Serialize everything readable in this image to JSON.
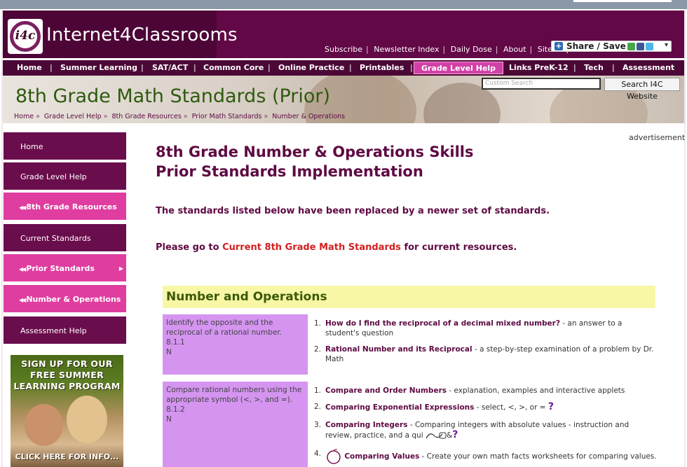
{
  "header": {
    "site_name": "Internet4Classrooms",
    "logo_text": "i4c",
    "toplinks": [
      "Subscribe",
      "Newsletter Index",
      "Daily Dose",
      "About",
      "Site Map"
    ],
    "share_label": "Share / Save"
  },
  "nav": {
    "items": [
      "Home",
      "Summer Learning",
      "SAT/ACT",
      "Common Core",
      "Online Practice",
      "Printables",
      "Grade Level Help",
      "Links PreK-12",
      "Tech",
      "Assessment"
    ],
    "active": "Grade Level Help"
  },
  "banner": {
    "title": "8th Grade Math Standards (Prior)",
    "search_placeholder": "Custom Search",
    "search_button": "Search I4C Website",
    "breadcrumbs": [
      "Home",
      "Grade Level Help",
      "8th Grade Resources",
      "Prior Math Standards",
      "Number & Operations"
    ]
  },
  "sidebar": {
    "items": [
      {
        "label": "Home",
        "style": "dark"
      },
      {
        "label": "Grade Level Help",
        "style": "dark"
      },
      {
        "label": "8th Grade Resources",
        "style": "pink"
      },
      {
        "label": "Current Standards",
        "style": "dark"
      },
      {
        "label": "Prior Standards",
        "style": "pink"
      },
      {
        "label": "Number & Operations",
        "style": "pink"
      },
      {
        "label": "Assessment Help",
        "style": "dark"
      }
    ],
    "ad": {
      "line1": "SIGN UP FOR OUR",
      "line2": "FREE SUMMER",
      "line3": "LEARNING PROGRAM",
      "cta": "CLICK HERE FOR INFO..."
    }
  },
  "main": {
    "advertisement_label": "advertisement",
    "title_line1": "8th Grade Number & Operations Skills",
    "title_line2": "Prior Standards Implementation",
    "notice": "The standards listed below have been replaced by a newer set of standards.",
    "goto_prefix": "Please go to",
    "goto_link": "Current 8th Grade Math Standards",
    "goto_suffix": "for current resources.",
    "section_title": "Number and Operations",
    "standards": [
      {
        "text": "Identify the opposite and the reciprocal of a rational number.",
        "code": "8.1.1",
        "type": "N",
        "resources": [
          {
            "num": "1.",
            "title": "How do I find the reciprocal of a decimal mixed number?",
            "desc": " - an answer to a student's question"
          },
          {
            "num": "2.",
            "title": "Rational Number and its Reciprocal",
            "desc": "  - a step-by-step examination of a problem by Dr. Math"
          }
        ]
      },
      {
        "text": "Compare rational numbers using the appropriate symbol (<, >, and =).",
        "code": "8.1.2",
        "type": "N",
        "resources": [
          {
            "num": "1.",
            "title": "Compare and Order Numbers",
            "desc": "  - explanation, examples and interactive applets"
          },
          {
            "num": "2.",
            "title": "Comparing Exponential Expressions",
            "desc": "  - select, <, >, or ="
          },
          {
            "num": "3.",
            "title": "Comparing Integers",
            "desc": " - Comparing integers with absolute values - instruction and review, practice, and a qui"
          },
          {
            "num": "4.",
            "title": "Comparing Values",
            "desc": " - Create your own math facts worksheets for comparing values."
          }
        ]
      }
    ],
    "res3_suffix": "&"
  }
}
